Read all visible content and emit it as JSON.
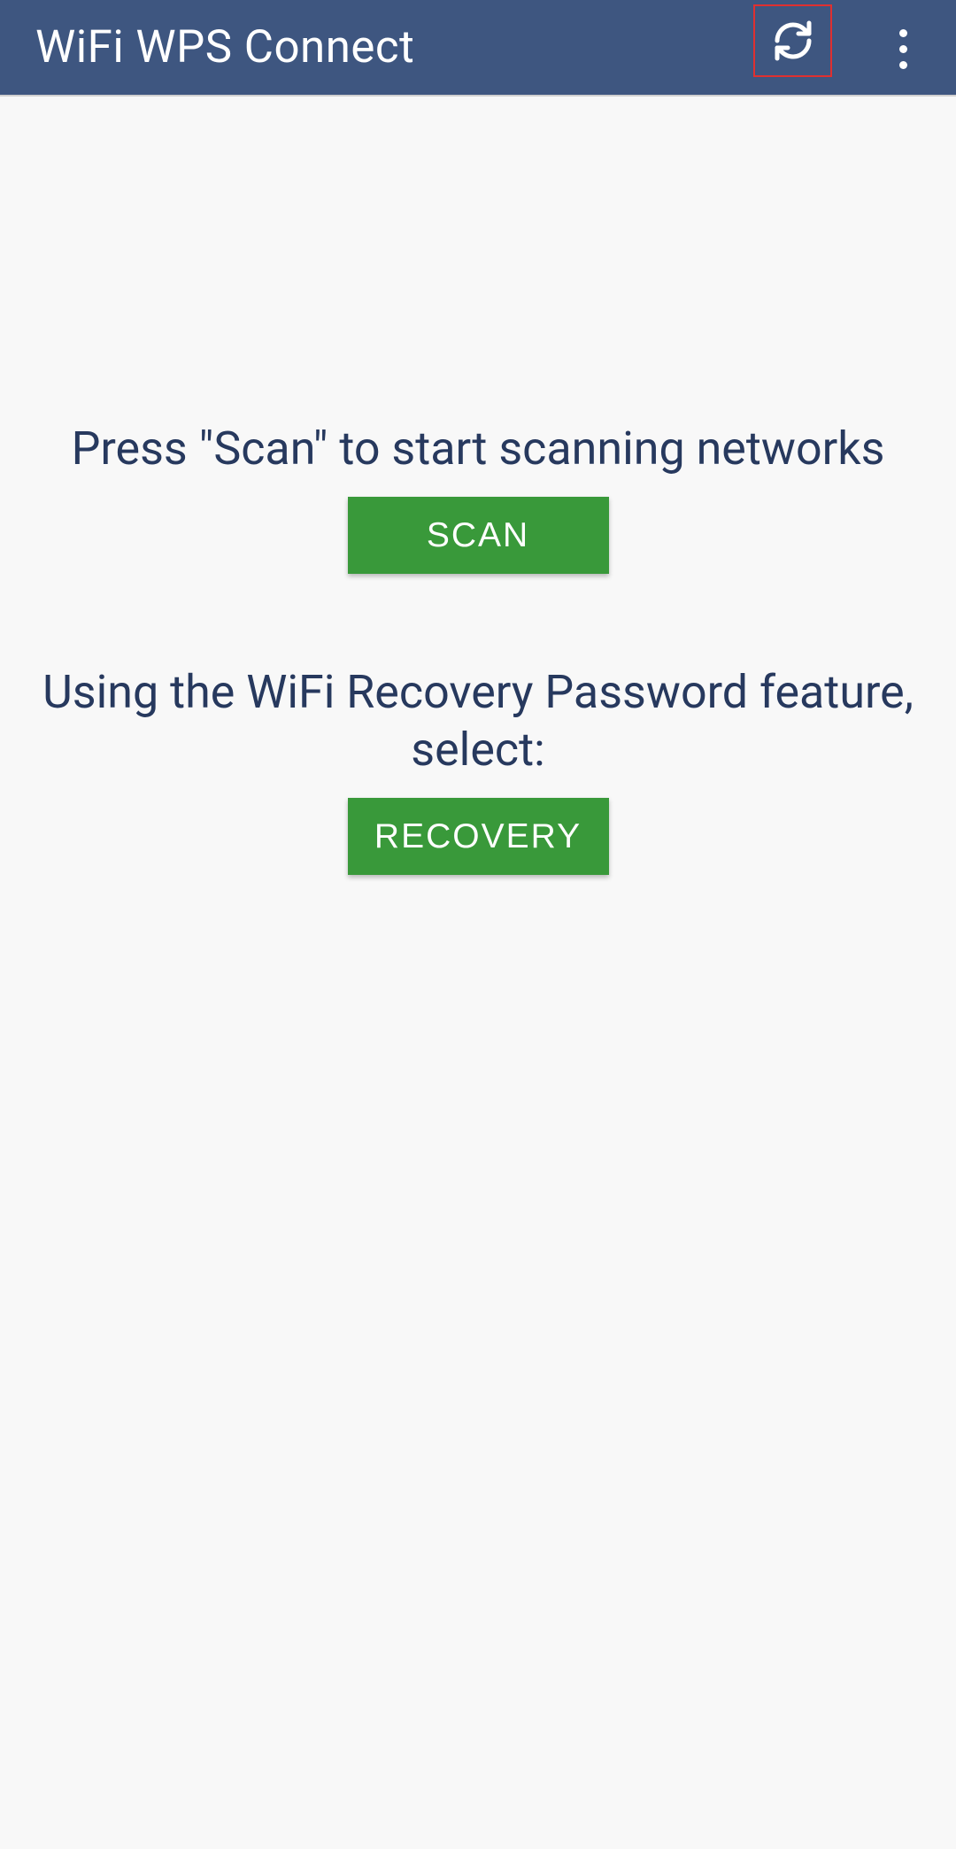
{
  "header": {
    "title": "WiFi WPS Connect"
  },
  "content": {
    "scan_instruction": "Press \"Scan\" to start scanning networks",
    "scan_button_label": "SCAN",
    "recovery_instruction": "Using the WiFi Recovery Password feature, select:",
    "recovery_button_label": "RECOVERY"
  },
  "colors": {
    "header_bg": "#3e5680",
    "button_bg": "#39993a",
    "text_color": "#27395e",
    "highlight_border": "#e03030"
  }
}
